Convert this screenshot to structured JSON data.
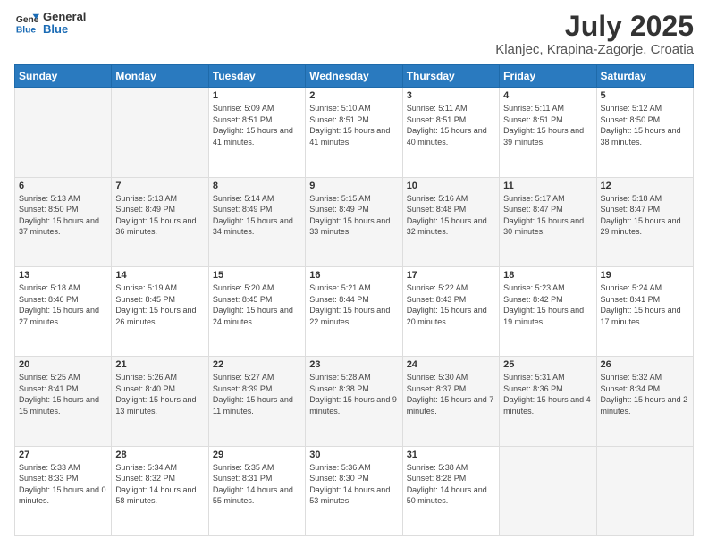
{
  "header": {
    "logo_line1": "General",
    "logo_line2": "Blue",
    "title": "July 2025",
    "subtitle": "Klanjec, Krapina-Zagorje, Croatia"
  },
  "weekdays": [
    "Sunday",
    "Monday",
    "Tuesday",
    "Wednesday",
    "Thursday",
    "Friday",
    "Saturday"
  ],
  "weeks": [
    [
      {
        "day": "",
        "sunrise": "",
        "sunset": "",
        "daylight": ""
      },
      {
        "day": "",
        "sunrise": "",
        "sunset": "",
        "daylight": ""
      },
      {
        "day": "1",
        "sunrise": "Sunrise: 5:09 AM",
        "sunset": "Sunset: 8:51 PM",
        "daylight": "Daylight: 15 hours and 41 minutes."
      },
      {
        "day": "2",
        "sunrise": "Sunrise: 5:10 AM",
        "sunset": "Sunset: 8:51 PM",
        "daylight": "Daylight: 15 hours and 41 minutes."
      },
      {
        "day": "3",
        "sunrise": "Sunrise: 5:11 AM",
        "sunset": "Sunset: 8:51 PM",
        "daylight": "Daylight: 15 hours and 40 minutes."
      },
      {
        "day": "4",
        "sunrise": "Sunrise: 5:11 AM",
        "sunset": "Sunset: 8:51 PM",
        "daylight": "Daylight: 15 hours and 39 minutes."
      },
      {
        "day": "5",
        "sunrise": "Sunrise: 5:12 AM",
        "sunset": "Sunset: 8:50 PM",
        "daylight": "Daylight: 15 hours and 38 minutes."
      }
    ],
    [
      {
        "day": "6",
        "sunrise": "Sunrise: 5:13 AM",
        "sunset": "Sunset: 8:50 PM",
        "daylight": "Daylight: 15 hours and 37 minutes."
      },
      {
        "day": "7",
        "sunrise": "Sunrise: 5:13 AM",
        "sunset": "Sunset: 8:49 PM",
        "daylight": "Daylight: 15 hours and 36 minutes."
      },
      {
        "day": "8",
        "sunrise": "Sunrise: 5:14 AM",
        "sunset": "Sunset: 8:49 PM",
        "daylight": "Daylight: 15 hours and 34 minutes."
      },
      {
        "day": "9",
        "sunrise": "Sunrise: 5:15 AM",
        "sunset": "Sunset: 8:49 PM",
        "daylight": "Daylight: 15 hours and 33 minutes."
      },
      {
        "day": "10",
        "sunrise": "Sunrise: 5:16 AM",
        "sunset": "Sunset: 8:48 PM",
        "daylight": "Daylight: 15 hours and 32 minutes."
      },
      {
        "day": "11",
        "sunrise": "Sunrise: 5:17 AM",
        "sunset": "Sunset: 8:47 PM",
        "daylight": "Daylight: 15 hours and 30 minutes."
      },
      {
        "day": "12",
        "sunrise": "Sunrise: 5:18 AM",
        "sunset": "Sunset: 8:47 PM",
        "daylight": "Daylight: 15 hours and 29 minutes."
      }
    ],
    [
      {
        "day": "13",
        "sunrise": "Sunrise: 5:18 AM",
        "sunset": "Sunset: 8:46 PM",
        "daylight": "Daylight: 15 hours and 27 minutes."
      },
      {
        "day": "14",
        "sunrise": "Sunrise: 5:19 AM",
        "sunset": "Sunset: 8:45 PM",
        "daylight": "Daylight: 15 hours and 26 minutes."
      },
      {
        "day": "15",
        "sunrise": "Sunrise: 5:20 AM",
        "sunset": "Sunset: 8:45 PM",
        "daylight": "Daylight: 15 hours and 24 minutes."
      },
      {
        "day": "16",
        "sunrise": "Sunrise: 5:21 AM",
        "sunset": "Sunset: 8:44 PM",
        "daylight": "Daylight: 15 hours and 22 minutes."
      },
      {
        "day": "17",
        "sunrise": "Sunrise: 5:22 AM",
        "sunset": "Sunset: 8:43 PM",
        "daylight": "Daylight: 15 hours and 20 minutes."
      },
      {
        "day": "18",
        "sunrise": "Sunrise: 5:23 AM",
        "sunset": "Sunset: 8:42 PM",
        "daylight": "Daylight: 15 hours and 19 minutes."
      },
      {
        "day": "19",
        "sunrise": "Sunrise: 5:24 AM",
        "sunset": "Sunset: 8:41 PM",
        "daylight": "Daylight: 15 hours and 17 minutes."
      }
    ],
    [
      {
        "day": "20",
        "sunrise": "Sunrise: 5:25 AM",
        "sunset": "Sunset: 8:41 PM",
        "daylight": "Daylight: 15 hours and 15 minutes."
      },
      {
        "day": "21",
        "sunrise": "Sunrise: 5:26 AM",
        "sunset": "Sunset: 8:40 PM",
        "daylight": "Daylight: 15 hours and 13 minutes."
      },
      {
        "day": "22",
        "sunrise": "Sunrise: 5:27 AM",
        "sunset": "Sunset: 8:39 PM",
        "daylight": "Daylight: 15 hours and 11 minutes."
      },
      {
        "day": "23",
        "sunrise": "Sunrise: 5:28 AM",
        "sunset": "Sunset: 8:38 PM",
        "daylight": "Daylight: 15 hours and 9 minutes."
      },
      {
        "day": "24",
        "sunrise": "Sunrise: 5:30 AM",
        "sunset": "Sunset: 8:37 PM",
        "daylight": "Daylight: 15 hours and 7 minutes."
      },
      {
        "day": "25",
        "sunrise": "Sunrise: 5:31 AM",
        "sunset": "Sunset: 8:36 PM",
        "daylight": "Daylight: 15 hours and 4 minutes."
      },
      {
        "day": "26",
        "sunrise": "Sunrise: 5:32 AM",
        "sunset": "Sunset: 8:34 PM",
        "daylight": "Daylight: 15 hours and 2 minutes."
      }
    ],
    [
      {
        "day": "27",
        "sunrise": "Sunrise: 5:33 AM",
        "sunset": "Sunset: 8:33 PM",
        "daylight": "Daylight: 15 hours and 0 minutes."
      },
      {
        "day": "28",
        "sunrise": "Sunrise: 5:34 AM",
        "sunset": "Sunset: 8:32 PM",
        "daylight": "Daylight: 14 hours and 58 minutes."
      },
      {
        "day": "29",
        "sunrise": "Sunrise: 5:35 AM",
        "sunset": "Sunset: 8:31 PM",
        "daylight": "Daylight: 14 hours and 55 minutes."
      },
      {
        "day": "30",
        "sunrise": "Sunrise: 5:36 AM",
        "sunset": "Sunset: 8:30 PM",
        "daylight": "Daylight: 14 hours and 53 minutes."
      },
      {
        "day": "31",
        "sunrise": "Sunrise: 5:38 AM",
        "sunset": "Sunset: 8:28 PM",
        "daylight": "Daylight: 14 hours and 50 minutes."
      },
      {
        "day": "",
        "sunrise": "",
        "sunset": "",
        "daylight": ""
      },
      {
        "day": "",
        "sunrise": "",
        "sunset": "",
        "daylight": ""
      }
    ]
  ]
}
